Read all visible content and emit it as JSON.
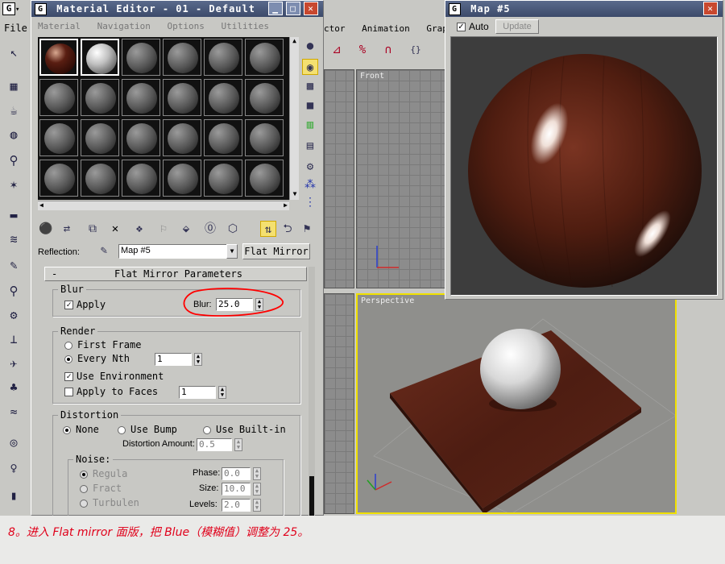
{
  "app": {
    "menu_file": "File",
    "main_menu": [
      "ctor",
      "Animation",
      "Graph Ed"
    ]
  },
  "material_editor": {
    "title": "Material Editor - 01 - Default",
    "menu": [
      "Material",
      "Navigation",
      "Options",
      "Utilities"
    ],
    "reflection_label": "Reflection:",
    "map_name": "Map #5",
    "map_type_button": "Flat Mirror",
    "rollout_title": "Flat Mirror Parameters",
    "rollout_toggle": "-",
    "blur": {
      "group_label": "Blur",
      "apply_label": "Apply",
      "apply_checked": true,
      "blur_label": "Blur:",
      "blur_value": "25.0"
    },
    "render": {
      "group_label": "Render",
      "first_frame": "First Frame",
      "every_nth": "Every Nth",
      "every_nth_value": "1",
      "use_env": "Use Environment",
      "apply_faces": "Apply to Faces",
      "apply_faces_value": "1"
    },
    "distortion": {
      "group_label": "Distortion",
      "none": "None",
      "use_bump": "Use Bump",
      "use_builtin": "Use Built-in",
      "amount_label": "Distortion Amount:",
      "amount_value": "0.5"
    },
    "noise": {
      "group_label": "Noise:",
      "regular": "Regula",
      "fract": "Fract",
      "turbulence": "Turbulen",
      "phase_label": "Phase:",
      "phase_value": "0.0",
      "size_label": "Size:",
      "size_value": "10.0",
      "levels_label": "Levels:",
      "levels_value": "2.0"
    }
  },
  "map_window": {
    "title": "Map #5",
    "auto_label": "Auto",
    "update_button": "Update"
  },
  "viewports": {
    "front": "Front",
    "perspective": "Perspective"
  },
  "caption": "8。进入 Flat mirror 面版，把 Blue（模糊值）调整为 25。",
  "colors": {
    "caption": "#e0001a",
    "annotation": "#ff0000",
    "active_viewport": "#f0e000"
  }
}
